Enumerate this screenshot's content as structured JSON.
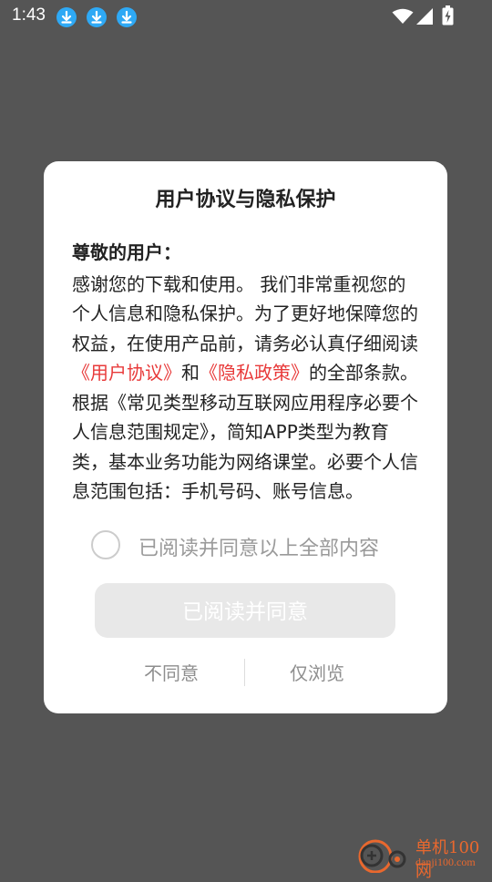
{
  "status_bar": {
    "time": "1:43",
    "icons": [
      "download-icon",
      "download-icon",
      "download-icon",
      "wifi-icon",
      "signal-icon",
      "battery-charging-icon"
    ]
  },
  "dialog": {
    "title": "用户协议与隐私保护",
    "greeting": "尊敬的用户：",
    "body_part1": "感谢您的下载和使用。 我们非常重视您的个人信息和隐私保护。为了更好地保障您的权益，在使用产品前，请务必认真仔细阅读",
    "link_user_agreement": "《用户协议》",
    "body_and": "和",
    "link_privacy_policy": "《隐私政策》",
    "body_part2": "的全部条款。 根据《常见类型移动互联网应用程序必要个人信息范围规定》，简知APP类型为教育类，基本业务功能为网络课堂。必要个人信息范围包括：手机号码、账号信息。",
    "checkbox_label": "已阅读并同意以上全部内容",
    "primary_button": "已阅读并同意",
    "disagree_button": "不同意",
    "browse_only_button": "仅浏览"
  },
  "watermark": {
    "title": "单机100网",
    "url": "danji100.com"
  },
  "colors": {
    "overlay": "#555555",
    "link": "#e83a3a",
    "download_badge": "#2ea9f5",
    "watermark": "#e9682e"
  }
}
